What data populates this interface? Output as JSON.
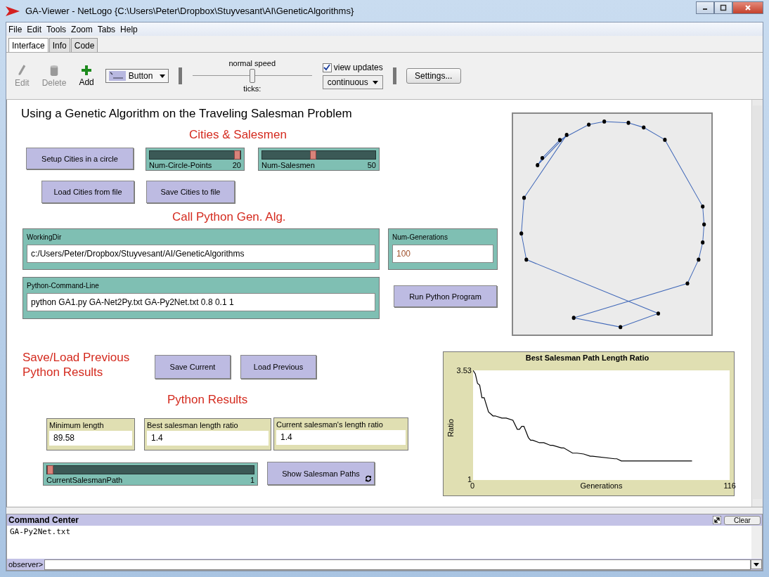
{
  "window": {
    "title": "GA-Viewer - NetLogo {C:\\Users\\Peter\\Dropbox\\Stuyvesant\\AI\\GeneticAlgorithms}"
  },
  "menu": [
    "File",
    "Edit",
    "Tools",
    "Zoom",
    "Tabs",
    "Help"
  ],
  "tabs": [
    {
      "label": "Interface",
      "selected": true
    },
    {
      "label": "Info",
      "selected": false
    },
    {
      "label": "Code",
      "selected": false
    }
  ],
  "toolbar": {
    "tools": [
      {
        "kind": "edit",
        "label": "Edit",
        "disabled": true
      },
      {
        "kind": "delete",
        "label": "Delete",
        "disabled": true
      },
      {
        "kind": "add",
        "label": "Add",
        "disabled": false
      }
    ],
    "widget_type": "Button",
    "speed": {
      "label": "normal speed",
      "level": 0.5
    },
    "ticks_label": "ticks:",
    "view_updates": {
      "label": "view updates",
      "checked": true
    },
    "update_mode": "continuous",
    "settings": "Settings..."
  },
  "widgets": [
    {
      "kind": "title",
      "text": "Using a Genetic Algorithm on the Traveling Salesman Problem"
    },
    {
      "kind": "heading",
      "text": "Cities & Salesmen"
    },
    {
      "kind": "button",
      "label": "Setup Cities in a circle",
      "forever": false
    },
    {
      "kind": "slider",
      "label": "Num-Circle-Points",
      "value": "20",
      "level": 1
    },
    {
      "kind": "slider",
      "label": "Num-Salesmen",
      "value": "50",
      "level": 0.45
    },
    {
      "kind": "button",
      "label": "Load Cities from file",
      "forever": false
    },
    {
      "kind": "button",
      "label": "Save Cities to file",
      "forever": false
    },
    {
      "kind": "heading",
      "text": "Call Python Gen. Alg."
    },
    {
      "kind": "input",
      "label": "WorkingDir",
      "value": "c:/Users/Peter/Dropbox/Stuyvesant/AI/GeneticAlgorithms",
      "numeric": false
    },
    {
      "kind": "input",
      "label": "Num-Generations",
      "value": "100",
      "numeric": true
    },
    {
      "kind": "input",
      "label": "Python-Command-Line",
      "value": "python GA1.py GA-Net2Py.txt GA-Py2Net.txt 0.8 0.1 1",
      "numeric": false
    },
    {
      "kind": "button",
      "label": "Run Python Program",
      "forever": false
    },
    {
      "kind": "heading",
      "text": "Save/Load Previous Python Results"
    },
    {
      "kind": "button",
      "label": "Save Current",
      "forever": false
    },
    {
      "kind": "button",
      "label": "Load Previous",
      "forever": false
    },
    {
      "kind": "heading",
      "text": "Python Results"
    },
    {
      "kind": "monitor",
      "label": "Minimum length",
      "value": "89.58"
    },
    {
      "kind": "monitor",
      "label": "Best salesman length ratio",
      "value": "1.4"
    },
    {
      "kind": "monitor",
      "label": "Current salesman's length ratio",
      "value": "1.4"
    },
    {
      "kind": "slider",
      "label": "CurrentSalesmanPath",
      "value": "1",
      "level": 0
    },
    {
      "kind": "button",
      "label": "Show Salesman Paths",
      "forever": true
    },
    {
      "kind": "view"
    },
    {
      "kind": "plot",
      "chart_data": {
        "type": "line",
        "title": "Best Salesman Path Length Ratio",
        "xlabel": "Generations",
        "ylabel": "Ratio",
        "xlim": [
          0,
          116
        ],
        "ylim": [
          1,
          3.53
        ],
        "xticks": [
          0,
          116
        ],
        "yticks": [
          1,
          3.53
        ],
        "x": [
          0,
          1,
          2,
          3,
          4,
          5,
          7,
          9,
          10,
          13,
          15,
          18,
          20,
          21,
          22,
          23,
          25,
          26,
          27,
          30,
          32,
          35,
          36,
          40,
          41,
          45,
          47,
          50,
          53,
          54,
          64,
          65,
          67,
          68,
          99
        ],
        "series": [
          {
            "color": "#000000",
            "values": [
              3.53,
              3.45,
              3.23,
              3.19,
              2.9,
              2.9,
              2.57,
              2.48,
              2.48,
              2.43,
              2.43,
              2.38,
              2.17,
              2.17,
              2.24,
              2.24,
              1.98,
              1.92,
              1.92,
              1.86,
              1.86,
              1.8,
              1.8,
              1.74,
              1.74,
              1.62,
              1.62,
              1.6,
              1.55,
              1.55,
              1.49,
              1.49,
              1.44,
              1.44,
              1.44
            ]
          }
        ]
      }
    }
  ],
  "command_center": {
    "title": "Command Center",
    "clear": "Clear",
    "output": "GA-Py2Net.txt",
    "prompt": "observer>"
  }
}
